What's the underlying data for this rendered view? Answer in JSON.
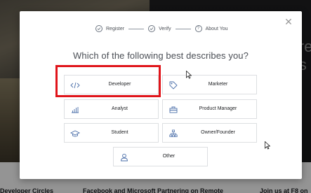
{
  "background": {
    "hero_text": "re\ns t",
    "strip_texts": [
      "Developer Circles",
      "Facebook and Microsoft Partnering on Remote",
      "Join us at F8 on"
    ]
  },
  "modal": {
    "close_icon": "close-icon",
    "steps": [
      {
        "label": "Register",
        "icon": "check-circle-icon"
      },
      {
        "label": "Verify",
        "icon": "check-circle-icon"
      },
      {
        "label": "About You",
        "icon": "question-circle-icon",
        "icon_text": "?"
      }
    ],
    "title": "Which of the following best describes you?",
    "options": [
      {
        "label": "Developer",
        "icon": "code-icon"
      },
      {
        "label": "Marketer",
        "icon": "tag-icon"
      },
      {
        "label": "Analyst",
        "icon": "bar-chart-icon"
      },
      {
        "label": "Product Manager",
        "icon": "briefcase-icon"
      },
      {
        "label": "Student",
        "icon": "graduation-cap-icon"
      },
      {
        "label": "Owner/Founder",
        "icon": "org-chart-icon"
      },
      {
        "label": "Other",
        "icon": "user-icon"
      }
    ],
    "highlighted_option": "Developer"
  },
  "colors": {
    "accent": "#4a6ea9",
    "highlight": "#e0141a",
    "border": "#dddfe2",
    "text": "#4b4f56"
  }
}
